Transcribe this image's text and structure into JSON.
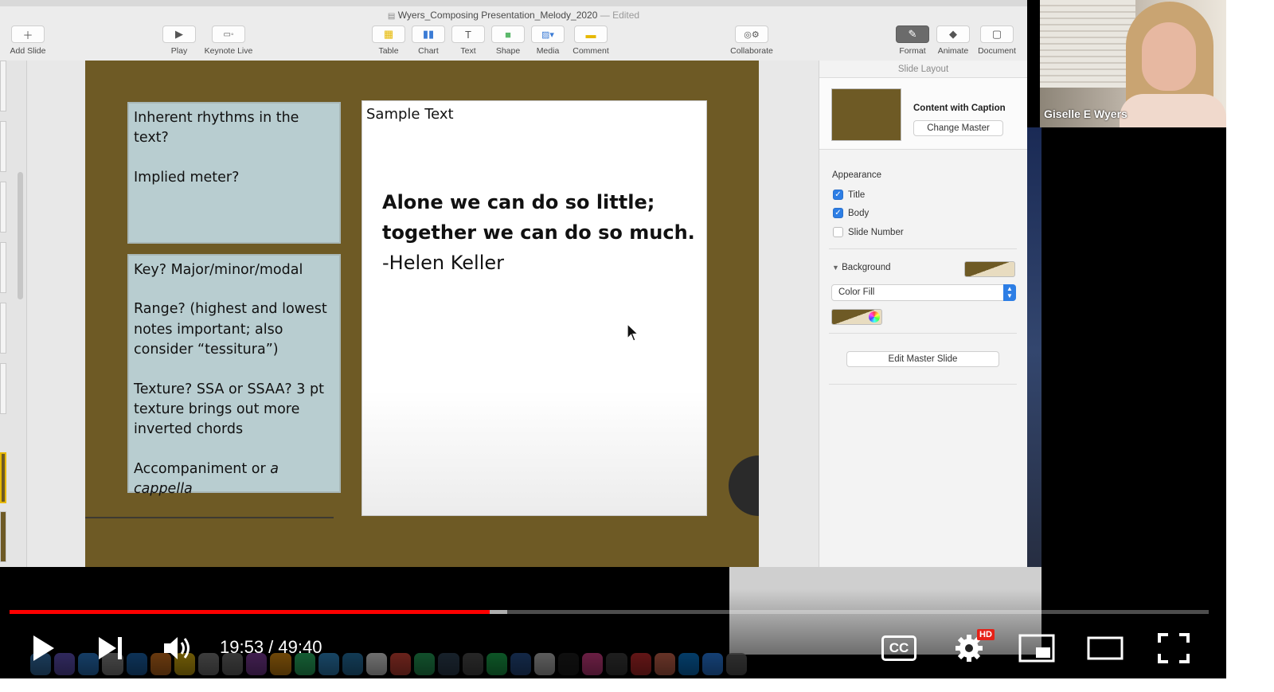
{
  "window": {
    "doc_title": "Wyers_Composing Presentation_Melody_2020",
    "edited_suffix": "— Edited"
  },
  "toolbar": {
    "add_slide": "Add Slide",
    "play": "Play",
    "keynote_live": "Keynote Live",
    "table": "Table",
    "chart": "Chart",
    "text": "Text",
    "shape": "Shape",
    "media": "Media",
    "comment": "Comment",
    "collaborate": "Collaborate",
    "format": "Format",
    "animate": "Animate",
    "document": "Document"
  },
  "slide": {
    "top_card": [
      "Inherent rhythms in the text?",
      "Implied meter?"
    ],
    "bottom_card": {
      "key": "Key? Major/minor/modal",
      "range": "Range? (highest and lowest notes important; also consider “tessitura”)",
      "texture": "Texture? SSA or SSAA? 3 pt texture brings out more inverted chords",
      "accomp_prefix": "Accompaniment or ",
      "accomp_italic": "a cappella"
    },
    "sample_label": "Sample Text",
    "quote_line1": "Alone we can do so little;",
    "quote_line2": "together we can do so much.",
    "quote_author": "-Helen Keller",
    "background_color": "#6e5a25"
  },
  "inspector": {
    "header": "Slide Layout",
    "layout_name": "Content with Caption",
    "change_master": "Change Master",
    "appearance_label": "Appearance",
    "title_check": "Title",
    "body_check": "Body",
    "slide_number_check": "Slide Number",
    "title_checked": true,
    "body_checked": true,
    "slide_number_checked": false,
    "background_label": "Background",
    "fill_type": "Color Fill",
    "edit_master": "Edit Master Slide"
  },
  "webcam": {
    "participant_name": "Giselle E Wyers"
  },
  "player": {
    "time": "19:53 / 49:40",
    "played_fraction": 0.4003,
    "buffered_fraction": 0.4153,
    "cc_label": "CC",
    "hd_badge": "HD",
    "accent": "#ff0000"
  }
}
